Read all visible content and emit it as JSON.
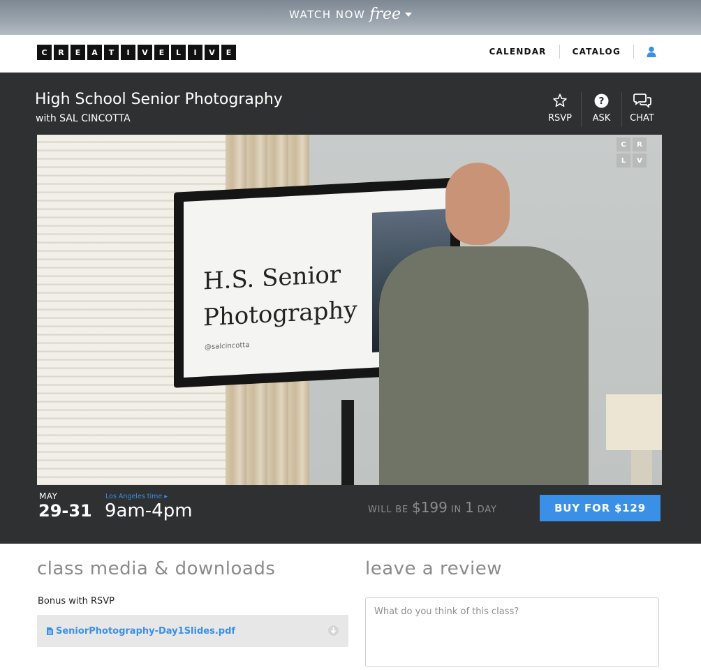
{
  "promo": {
    "watch_label": "WATCH NOW",
    "free_label": "free"
  },
  "brand": {
    "letters": [
      "C",
      "R",
      "E",
      "A",
      "T",
      "I",
      "V",
      "E",
      "L",
      "I",
      "V",
      "E"
    ]
  },
  "nav": {
    "calendar": "CALENDAR",
    "catalog": "CATALOG",
    "user_icon": "user-icon"
  },
  "course": {
    "title": "High School Senior Photography",
    "instructor": "with SAL CINCOTTA"
  },
  "actions": {
    "rsvp": "RSVP",
    "ask": "ASK",
    "chat": "CHAT"
  },
  "video": {
    "slide_title_line1": "H.S. Senior",
    "slide_title_line2": "Photography",
    "slide_handle": "@salcincotta",
    "watermark": [
      "C",
      "R",
      "L",
      "V"
    ]
  },
  "schedule": {
    "month": "MAY",
    "days": "29-31",
    "timezone_link": "Los Angeles time",
    "time": "9am-4pm"
  },
  "pricing": {
    "will_be": "WILL BE",
    "future_price": "$199",
    "in": "IN",
    "days_count": "1",
    "day_label": "DAY",
    "buy_label": "BUY FOR $129"
  },
  "media": {
    "title": "class media & downloads",
    "bonus_label": "Bonus with RSVP",
    "file_name": "SeniorPhotography-Day1Slides.pdf"
  },
  "review": {
    "title": "leave a review",
    "placeholder": "What do you think of this class?"
  },
  "colors": {
    "accent": "#3a8fe6",
    "stage_bg": "#2f3031"
  }
}
